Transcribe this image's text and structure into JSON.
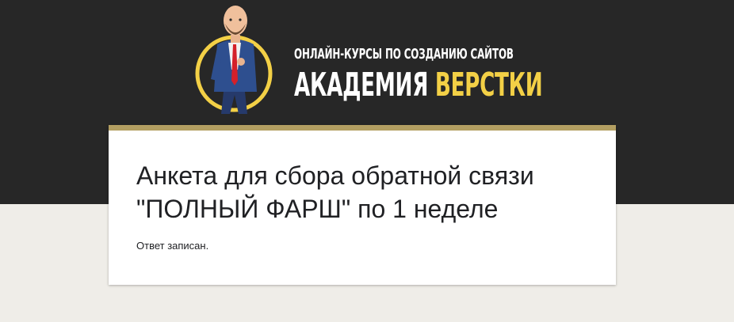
{
  "header": {
    "logo_icon": "academy-mascot-logo",
    "subtitle": "ОНЛАЙН-КУРСЫ ПО СОЗДАНИЮ САЙТОВ",
    "title_part1": "АКАДЕМИЯ",
    "title_part2": "ВЕРСТКИ"
  },
  "form": {
    "title_line1": "Анкета для сбора обратной связи",
    "title_line2": "\"ПОЛНЫЙ ФАРШ\" по 1 неделе",
    "confirmation": "Ответ записан."
  },
  "colors": {
    "header_bg": "#272727",
    "page_bg": "#efede8",
    "accent": "#b39f62",
    "brand_yellow": "#f3d046"
  }
}
